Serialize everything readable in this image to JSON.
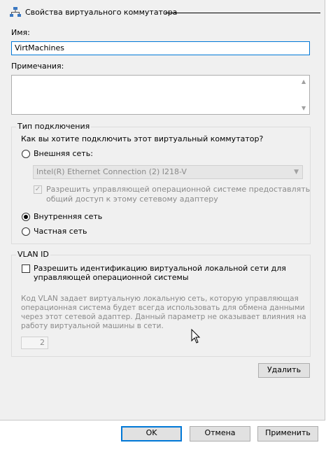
{
  "header": {
    "title": "Свойства виртуального коммутатора"
  },
  "name": {
    "label": "Имя:",
    "value": "VirtMachines"
  },
  "notes": {
    "label": "Примечания:",
    "value": ""
  },
  "connection": {
    "group_title": "Тип подключения",
    "question": "Как вы хотите подключить этот виртуальный коммутатор?",
    "external_label": "Внешняя сеть:",
    "adapter_value": "Intel(R) Ethernet Connection (2) I218-V",
    "share_line1": "Разрешить управляющей операционной системе предоставлять",
    "share_line2": "общий доступ к этому сетевому адаптеру",
    "internal_label": "Внутренняя сеть",
    "private_label": "Частная сеть",
    "selected": "internal"
  },
  "vlan": {
    "group_title": "VLAN ID",
    "enable_line1": "Разрешить идентификацию виртуальной локальной сети для",
    "enable_line2": "управляющей операционной системы",
    "desc_lines": [
      "Код VLAN задает виртуальную локальную сеть, которую управляющая",
      "операционная система будет всегда использовать для обмена данными",
      "через этот сетевой адаптер. Данный параметр не оказывает влияния на",
      "работу виртуальной машины в сети."
    ],
    "id_value": "2"
  },
  "buttons": {
    "remove": "Удалить",
    "ok": "OK",
    "cancel": "Отмена",
    "apply": "Применить"
  }
}
